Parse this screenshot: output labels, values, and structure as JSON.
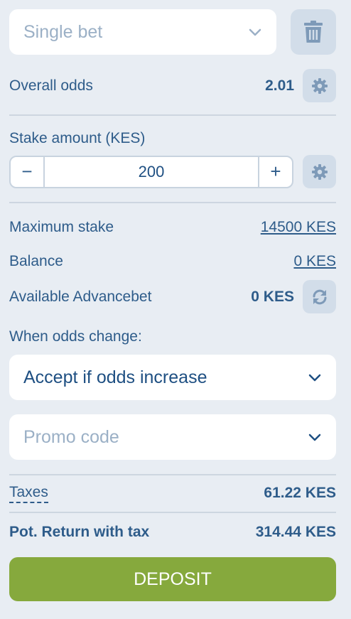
{
  "bet_type": {
    "value": "Single bet"
  },
  "overall_odds": {
    "label": "Overall odds",
    "value": "2.01"
  },
  "stake": {
    "label": "Stake amount (KES)",
    "minus": "−",
    "plus": "+",
    "value": "200"
  },
  "max_stake": {
    "label": "Maximum stake",
    "value": "14500 KES"
  },
  "balance": {
    "label": "Balance",
    "value": "0 KES"
  },
  "advancebet": {
    "label": "Available Advancebet",
    "value": "0 KES"
  },
  "odds_change": {
    "label": "When odds change:",
    "value": "Accept if odds increase"
  },
  "promo": {
    "placeholder": "Promo code"
  },
  "taxes": {
    "label": "Taxes",
    "value": "61.22 KES"
  },
  "pot_return": {
    "label": "Pot. Return with tax",
    "value": "314.44 KES"
  },
  "deposit": {
    "label": "DEPOSIT"
  },
  "colors": {
    "accent": "#86a93d",
    "text": "#2e5c8a",
    "background": "#e8edf3"
  },
  "icons": [
    "chevron-down-icon",
    "trash-icon",
    "gear-icon",
    "refresh-icon"
  ]
}
